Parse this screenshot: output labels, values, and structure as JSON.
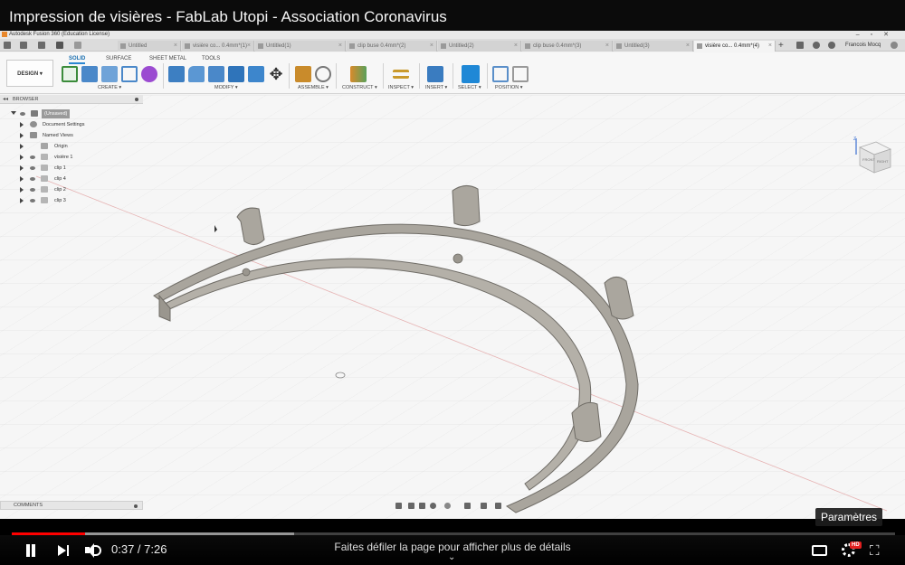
{
  "video": {
    "title": "Impression de visières - FabLab Utopi - Association Coronavirus",
    "time": "0:37 / 7:26",
    "progress_fraction": 0.083,
    "buffered_fraction": 0.32,
    "scroll_hint": "Faites défiler la page pour afficher plus de détails",
    "tooltip": "Paramètres",
    "hd_badge": "HD",
    "colors": {
      "progress": "#ff0000",
      "background": "#000000"
    }
  },
  "app": {
    "window_title": "Autodesk Fusion 360 (Education License)",
    "user": "Francois Mocq",
    "tabs": [
      {
        "label": "Untitled",
        "active": false
      },
      {
        "label": "visière co... 0.4mm*(1)",
        "active": false
      },
      {
        "label": "Untitled(1)",
        "active": false
      },
      {
        "label": "clip buse 0.4mm*(2)",
        "active": false
      },
      {
        "label": "Untitled(2)",
        "active": false
      },
      {
        "label": "clip buse 0.4mm*(3)",
        "active": false
      },
      {
        "label": "Untitled(3)",
        "active": false
      },
      {
        "label": "visière co... 0.4mm*(4)",
        "active": true
      }
    ],
    "workspace_button": "DESIGN ▾",
    "toolbar_tabs": [
      "SOLID",
      "SURFACE",
      "SHEET METAL",
      "TOOLS"
    ],
    "toolbar_groups": [
      "CREATE ▾",
      "MODIFY ▾",
      "ASSEMBLE ▾",
      "CONSTRUCT ▾",
      "INSPECT ▾",
      "INSERT ▾",
      "SELECT ▾",
      "POSITION ▾"
    ],
    "accent_color": "#2b87d1",
    "browser": {
      "header": "BROWSER",
      "items": [
        {
          "label": "(Unsaved)",
          "icon": "component-icon"
        },
        {
          "label": "Document Settings",
          "icon": "gear-icon"
        },
        {
          "label": "Named Views",
          "icon": "folder-icon"
        },
        {
          "label": "Origin",
          "icon": "folder-icon"
        },
        {
          "label": "visière 1",
          "icon": "body-icon"
        },
        {
          "label": "clip 1",
          "icon": "body-icon"
        },
        {
          "label": "clip 4",
          "icon": "body-icon"
        },
        {
          "label": "clip 2",
          "icon": "body-icon"
        },
        {
          "label": "clip 3",
          "icon": "body-icon"
        }
      ]
    },
    "comments_header": "COMMENTS",
    "viewcube_faces": [
      "FRONT",
      "RIGHT"
    ],
    "model_color": "#a8a49c"
  }
}
